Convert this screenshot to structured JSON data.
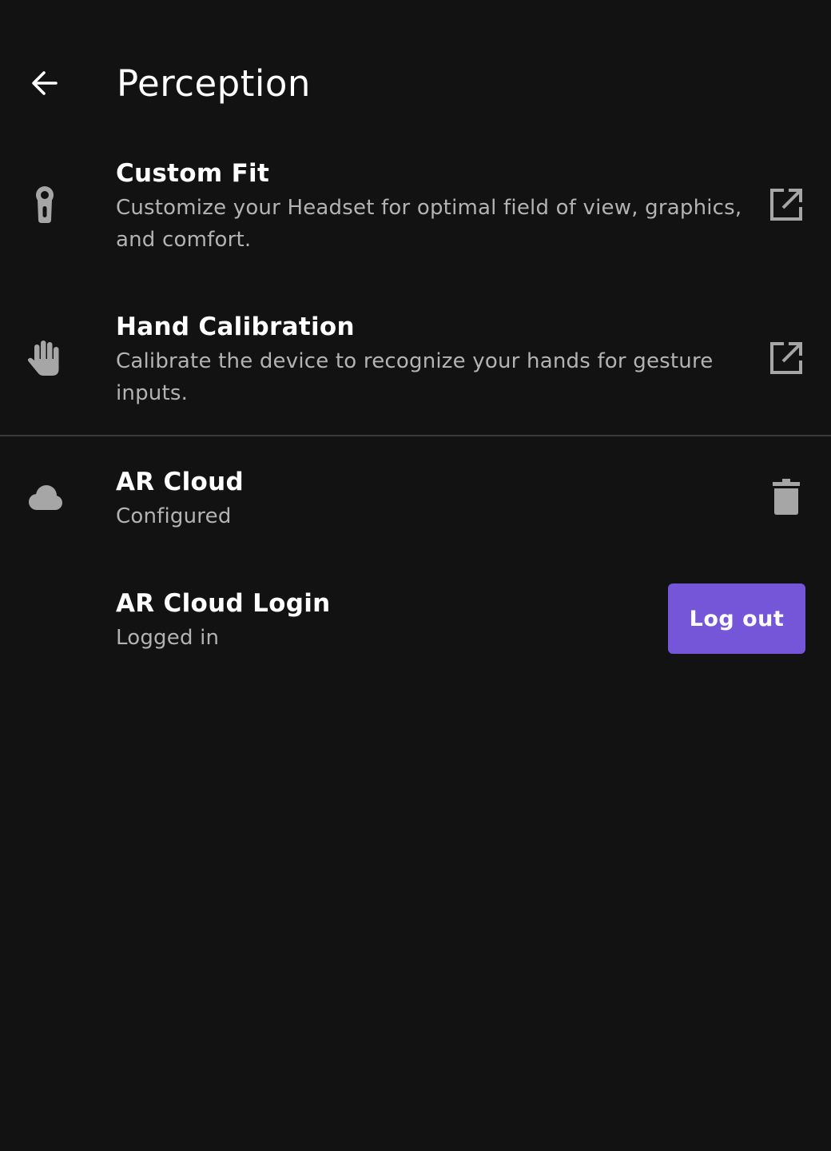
{
  "header": {
    "title": "Perception",
    "back_icon": "arrow-left-icon"
  },
  "colors": {
    "background": "#121212",
    "icon": "#a6a6a6",
    "primary_button": "#7556d9",
    "secondary_text": "#b3b3b3",
    "divider": "#3a3a3a"
  },
  "items": [
    {
      "title": "Custom Fit",
      "subtitle": "Customize your Headset for optimal field of view, graphics, and comfort.",
      "icon": "headset-fit-icon",
      "action_icon": "open-external-icon"
    },
    {
      "title": "Hand Calibration",
      "subtitle": "Calibrate the device to recognize your hands for gesture inputs.",
      "icon": "hand-icon",
      "action_icon": "open-external-icon"
    },
    {
      "title": "AR Cloud",
      "subtitle": "Configured",
      "icon": "cloud-icon",
      "action_icon": "trash-icon"
    },
    {
      "title": "AR Cloud Login",
      "subtitle": "Logged in",
      "button_label": "Log out"
    }
  ]
}
